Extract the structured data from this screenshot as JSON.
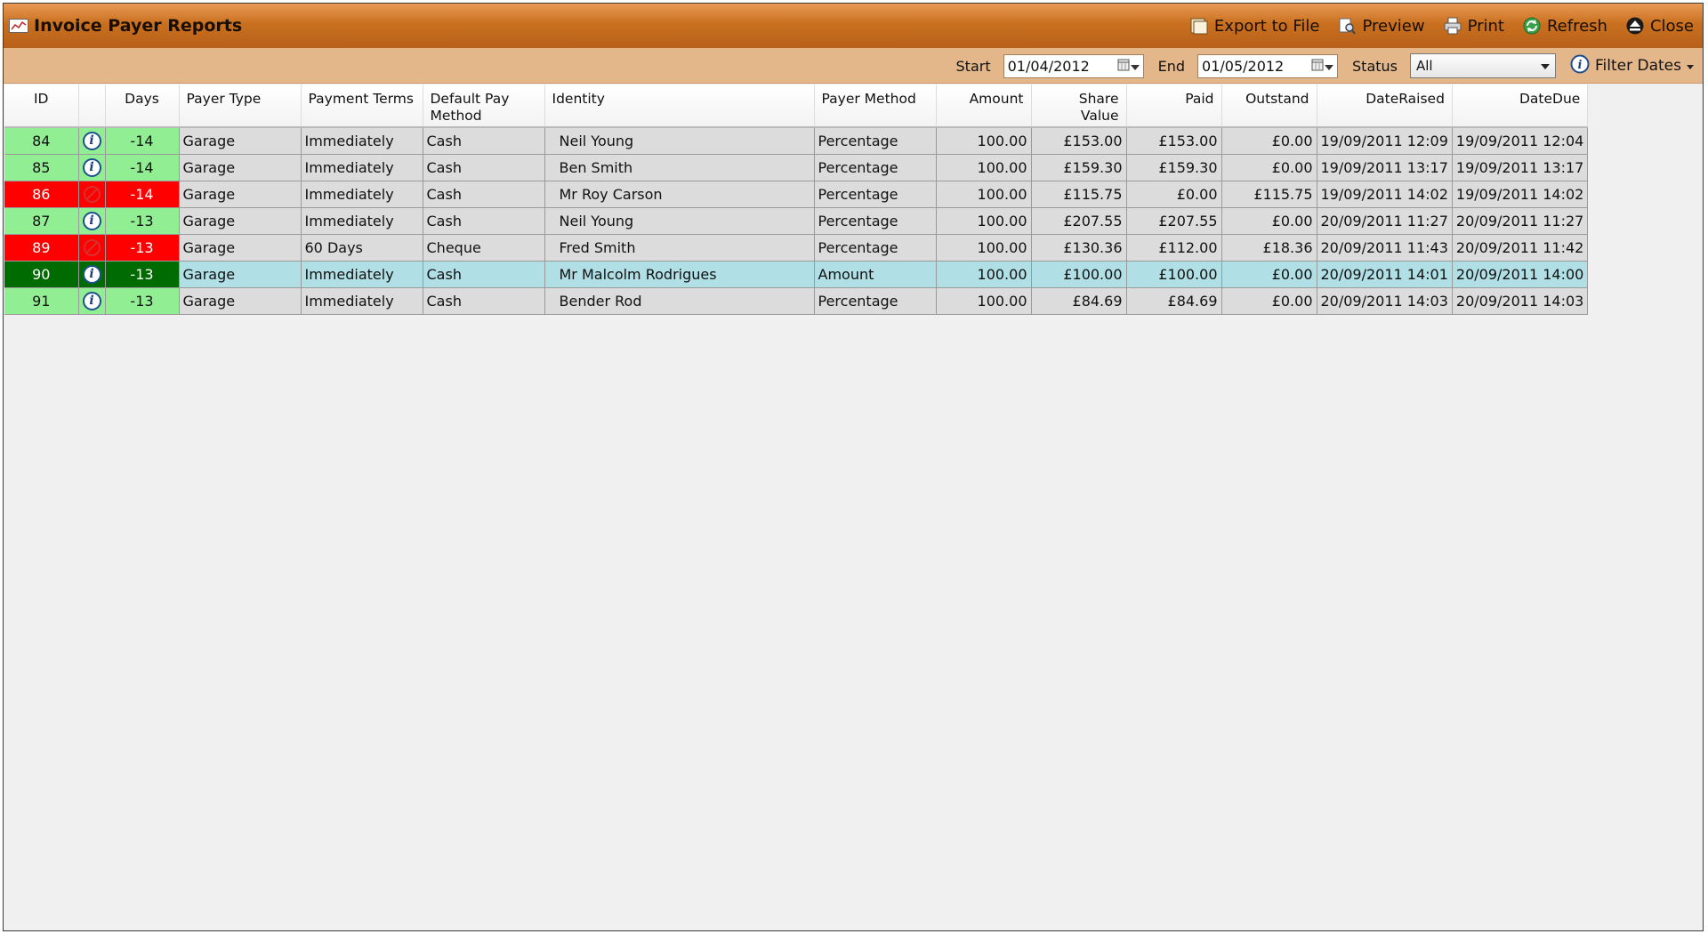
{
  "window": {
    "title": "Invoice Payer Reports",
    "actions": [
      {
        "label": "Export to File",
        "icon": "export-icon"
      },
      {
        "label": "Preview",
        "icon": "preview-icon"
      },
      {
        "label": "Print",
        "icon": "print-icon"
      },
      {
        "label": "Refresh",
        "icon": "refresh-icon"
      },
      {
        "label": "Close",
        "icon": "close-icon"
      }
    ]
  },
  "filters": {
    "start_label": "Start",
    "start_value": "01/04/2012",
    "end_label": "End",
    "end_value": "01/05/2012",
    "status_label": "Status",
    "status_value": "All",
    "filter_dates_label": "Filter Dates"
  },
  "grid": {
    "columns": [
      "ID",
      "",
      "Days",
      "Payer Type",
      "Payment Terms",
      "Default Pay Method",
      "Identity",
      "Payer Method",
      "Amount",
      "Share Value",
      "Paid",
      "Outstand",
      "DateRaised",
      "DateDue"
    ],
    "rows": [
      {
        "id": "84",
        "status": "info",
        "days": "-14",
        "payer_type": "Garage",
        "payment_terms": "Immediately",
        "pay_method": "Cash",
        "identity": "Neil Young",
        "payer_method": "Percentage",
        "amount": "100.00",
        "share_value": "£153.00",
        "paid": "£153.00",
        "outstand": "£0.00",
        "date_raised": "19/09/2011 12:09",
        "date_due": "19/09/2011 12:04",
        "color": "green",
        "selected": false
      },
      {
        "id": "85",
        "status": "info",
        "days": "-14",
        "payer_type": "Garage",
        "payment_terms": "Immediately",
        "pay_method": "Cash",
        "identity": "Ben Smith",
        "payer_method": "Percentage",
        "amount": "100.00",
        "share_value": "£159.30",
        "paid": "£159.30",
        "outstand": "£0.00",
        "date_raised": "19/09/2011 13:17",
        "date_due": "19/09/2011 13:17",
        "color": "green",
        "selected": false
      },
      {
        "id": "86",
        "status": "blocked",
        "days": "-14",
        "payer_type": "Garage",
        "payment_terms": "Immediately",
        "pay_method": "Cash",
        "identity": "Mr Roy Carson",
        "payer_method": "Percentage",
        "amount": "100.00",
        "share_value": "£115.75",
        "paid": "£0.00",
        "outstand": "£115.75",
        "date_raised": "19/09/2011 14:02",
        "date_due": "19/09/2011 14:02",
        "color": "red",
        "selected": false
      },
      {
        "id": "87",
        "status": "info",
        "days": "-13",
        "payer_type": "Garage",
        "payment_terms": "Immediately",
        "pay_method": "Cash",
        "identity": "Neil Young",
        "payer_method": "Percentage",
        "amount": "100.00",
        "share_value": "£207.55",
        "paid": "£207.55",
        "outstand": "£0.00",
        "date_raised": "20/09/2011 11:27",
        "date_due": "20/09/2011 11:27",
        "color": "green",
        "selected": false
      },
      {
        "id": "89",
        "status": "blocked",
        "days": "-13",
        "payer_type": "Garage",
        "payment_terms": "60 Days",
        "pay_method": "Cheque",
        "identity": "Fred Smith",
        "payer_method": "Percentage",
        "amount": "100.00",
        "share_value": "£130.36",
        "paid": "£112.00",
        "outstand": "£18.36",
        "date_raised": "20/09/2011 11:43",
        "date_due": "20/09/2011 11:42",
        "color": "red",
        "selected": false
      },
      {
        "id": "90",
        "status": "info",
        "days": "-13",
        "payer_type": "Garage",
        "payment_terms": "Immediately",
        "pay_method": "Cash",
        "identity": "Mr Malcolm Rodrigues",
        "payer_method": "Amount",
        "amount": "100.00",
        "share_value": "£100.00",
        "paid": "£100.00",
        "outstand": "£0.00",
        "date_raised": "20/09/2011 14:01",
        "date_due": "20/09/2011 14:00",
        "color": "dkgreen",
        "selected": true
      },
      {
        "id": "91",
        "status": "info",
        "days": "-13",
        "payer_type": "Garage",
        "payment_terms": "Immediately",
        "pay_method": "Cash",
        "identity": "Bender Rod",
        "payer_method": "Percentage",
        "amount": "100.00",
        "share_value": "£84.69",
        "paid": "£84.69",
        "outstand": "£0.00",
        "date_raised": "20/09/2011 14:03",
        "date_due": "20/09/2011 14:03",
        "color": "green",
        "selected": false
      }
    ]
  },
  "colors": {
    "titlebar": "#c9701f",
    "filterbar": "#e4b78a",
    "row_green": "#92ee92",
    "row_red": "#ff0000",
    "row_dark_green": "#006b00",
    "row_selected": "#b0dfe6",
    "row_default": "#dcdcdc"
  }
}
